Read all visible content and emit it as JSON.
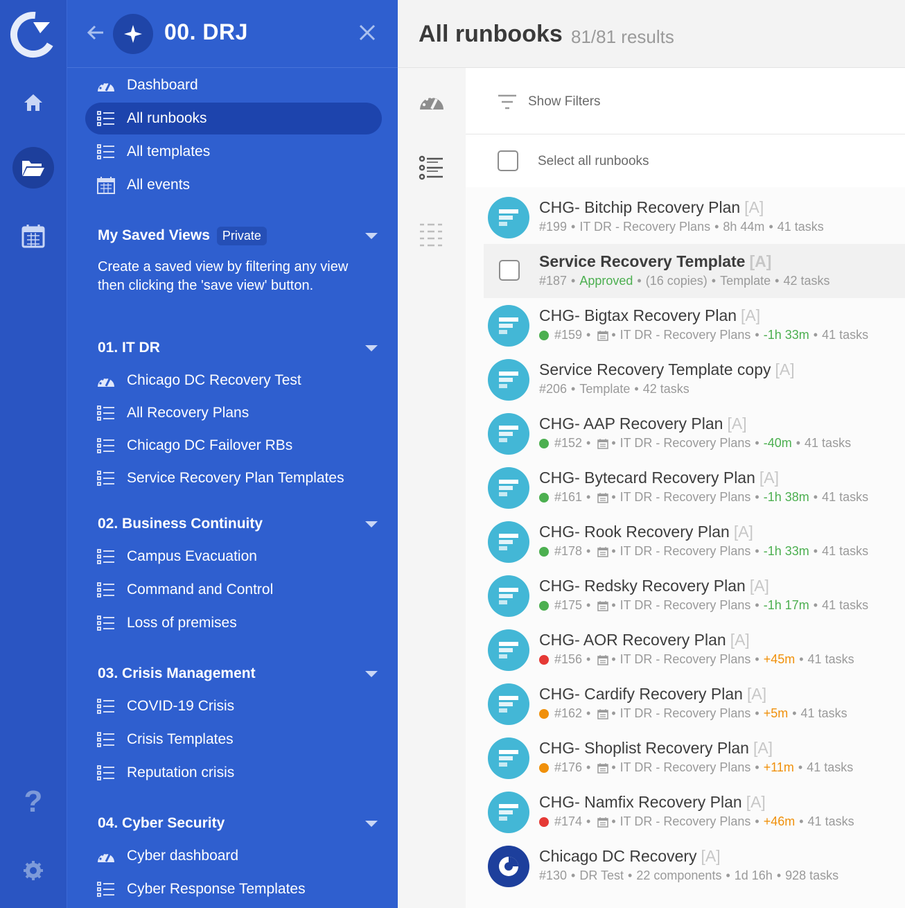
{
  "nav": {
    "workspace_title": "00. DRJ",
    "top_items": [
      {
        "label": "Dashboard",
        "icon": "dashboard-icon"
      },
      {
        "label": "All runbooks",
        "icon": "list-icon"
      },
      {
        "label": "All templates",
        "icon": "list-icon"
      },
      {
        "label": "All events",
        "icon": "calendar-icon"
      }
    ],
    "saved_views": {
      "title": "My Saved Views",
      "badge": "Private",
      "description": "Create a saved view by filtering any view then clicking the 'save view' button."
    },
    "sections": [
      {
        "title": "01. IT DR",
        "items": [
          "Chicago DC Recovery Test",
          "All Recovery Plans",
          "Chicago DC Failover RBs",
          "Service Recovery Plan Templates"
        ]
      },
      {
        "title": "02. Business Continuity",
        "items": [
          "Campus Evacuation",
          "Command and Control",
          "Loss of premises"
        ]
      },
      {
        "title": "03. Crisis Management",
        "items": [
          "COVID-19 Crisis",
          "Crisis Templates",
          "Reputation crisis"
        ]
      },
      {
        "title": "04. Cyber Security",
        "items": [
          "Cyber dashboard",
          "Cyber Response Templates"
        ]
      }
    ]
  },
  "main": {
    "title": "All runbooks",
    "results": "81/81 results",
    "show_filters": "Show Filters",
    "select_all": "Select all runbooks"
  },
  "runbooks": [
    {
      "title": "CHG- Bitchip Recovery Plan",
      "tag": "[A]",
      "meta": [
        "#199",
        "IT DR - Recovery Plans",
        "8h 44m",
        "41 tasks"
      ]
    },
    {
      "title": "Service Recovery Template",
      "tag": "[A]",
      "meta": [
        "#187",
        "Approved",
        "(16 copies)",
        "Template",
        "42 tasks"
      ]
    },
    {
      "title": "CHG- Bigtax Recovery Plan",
      "tag": "[A]",
      "meta": [
        "#159",
        "IT DR - Recovery Plans",
        "-1h 33m",
        "41 tasks"
      ]
    },
    {
      "title": "Service Recovery Template copy",
      "tag": "[A]",
      "meta": [
        "#206",
        "Template",
        "42 tasks"
      ]
    },
    {
      "title": "CHG- AAP Recovery Plan",
      "tag": "[A]",
      "meta": [
        "#152",
        "IT DR - Recovery Plans",
        "-40m",
        "41 tasks"
      ]
    },
    {
      "title": "CHG- Bytecard Recovery Plan",
      "tag": "[A]",
      "meta": [
        "#161",
        "IT DR - Recovery Plans",
        "-1h 38m",
        "41 tasks"
      ]
    },
    {
      "title": "CHG- Rook Recovery Plan",
      "tag": "[A]",
      "meta": [
        "#178",
        "IT DR - Recovery Plans",
        "-1h 33m",
        "41 tasks"
      ]
    },
    {
      "title": "CHG- Redsky Recovery Plan",
      "tag": "[A]",
      "meta": [
        "#175",
        "IT DR - Recovery Plans",
        "-1h 17m",
        "41 tasks"
      ]
    },
    {
      "title": "CHG- AOR Recovery Plan",
      "tag": "[A]",
      "meta": [
        "#156",
        "IT DR - Recovery Plans",
        "+45m",
        "41 tasks"
      ]
    },
    {
      "title": "CHG- Cardify Recovery Plan",
      "tag": "[A]",
      "meta": [
        "#162",
        "IT DR - Recovery Plans",
        "+5m",
        "41 tasks"
      ]
    },
    {
      "title": "CHG- Shoplist Recovery Plan",
      "tag": "[A]",
      "meta": [
        "#176",
        "IT DR - Recovery Plans",
        "+11m",
        "41 tasks"
      ]
    },
    {
      "title": "CHG- Namfix Recovery Plan",
      "tag": "[A]",
      "meta": [
        "#174",
        "IT DR - Recovery Plans",
        "+46m",
        "41 tasks"
      ]
    },
    {
      "title": "Chicago DC Recovery",
      "tag": "[A]",
      "meta": [
        "#130",
        "DR Test",
        "22 components",
        "1d 16h",
        "928 tasks"
      ]
    }
  ],
  "colors": {
    "rail": "#2a55c2",
    "nav": "#2f5fcf",
    "active": "#1d44ad",
    "avatar": "#43b7d6",
    "status_green": "#4caf50",
    "status_red": "#e53935",
    "status_orange": "#f0900a"
  }
}
